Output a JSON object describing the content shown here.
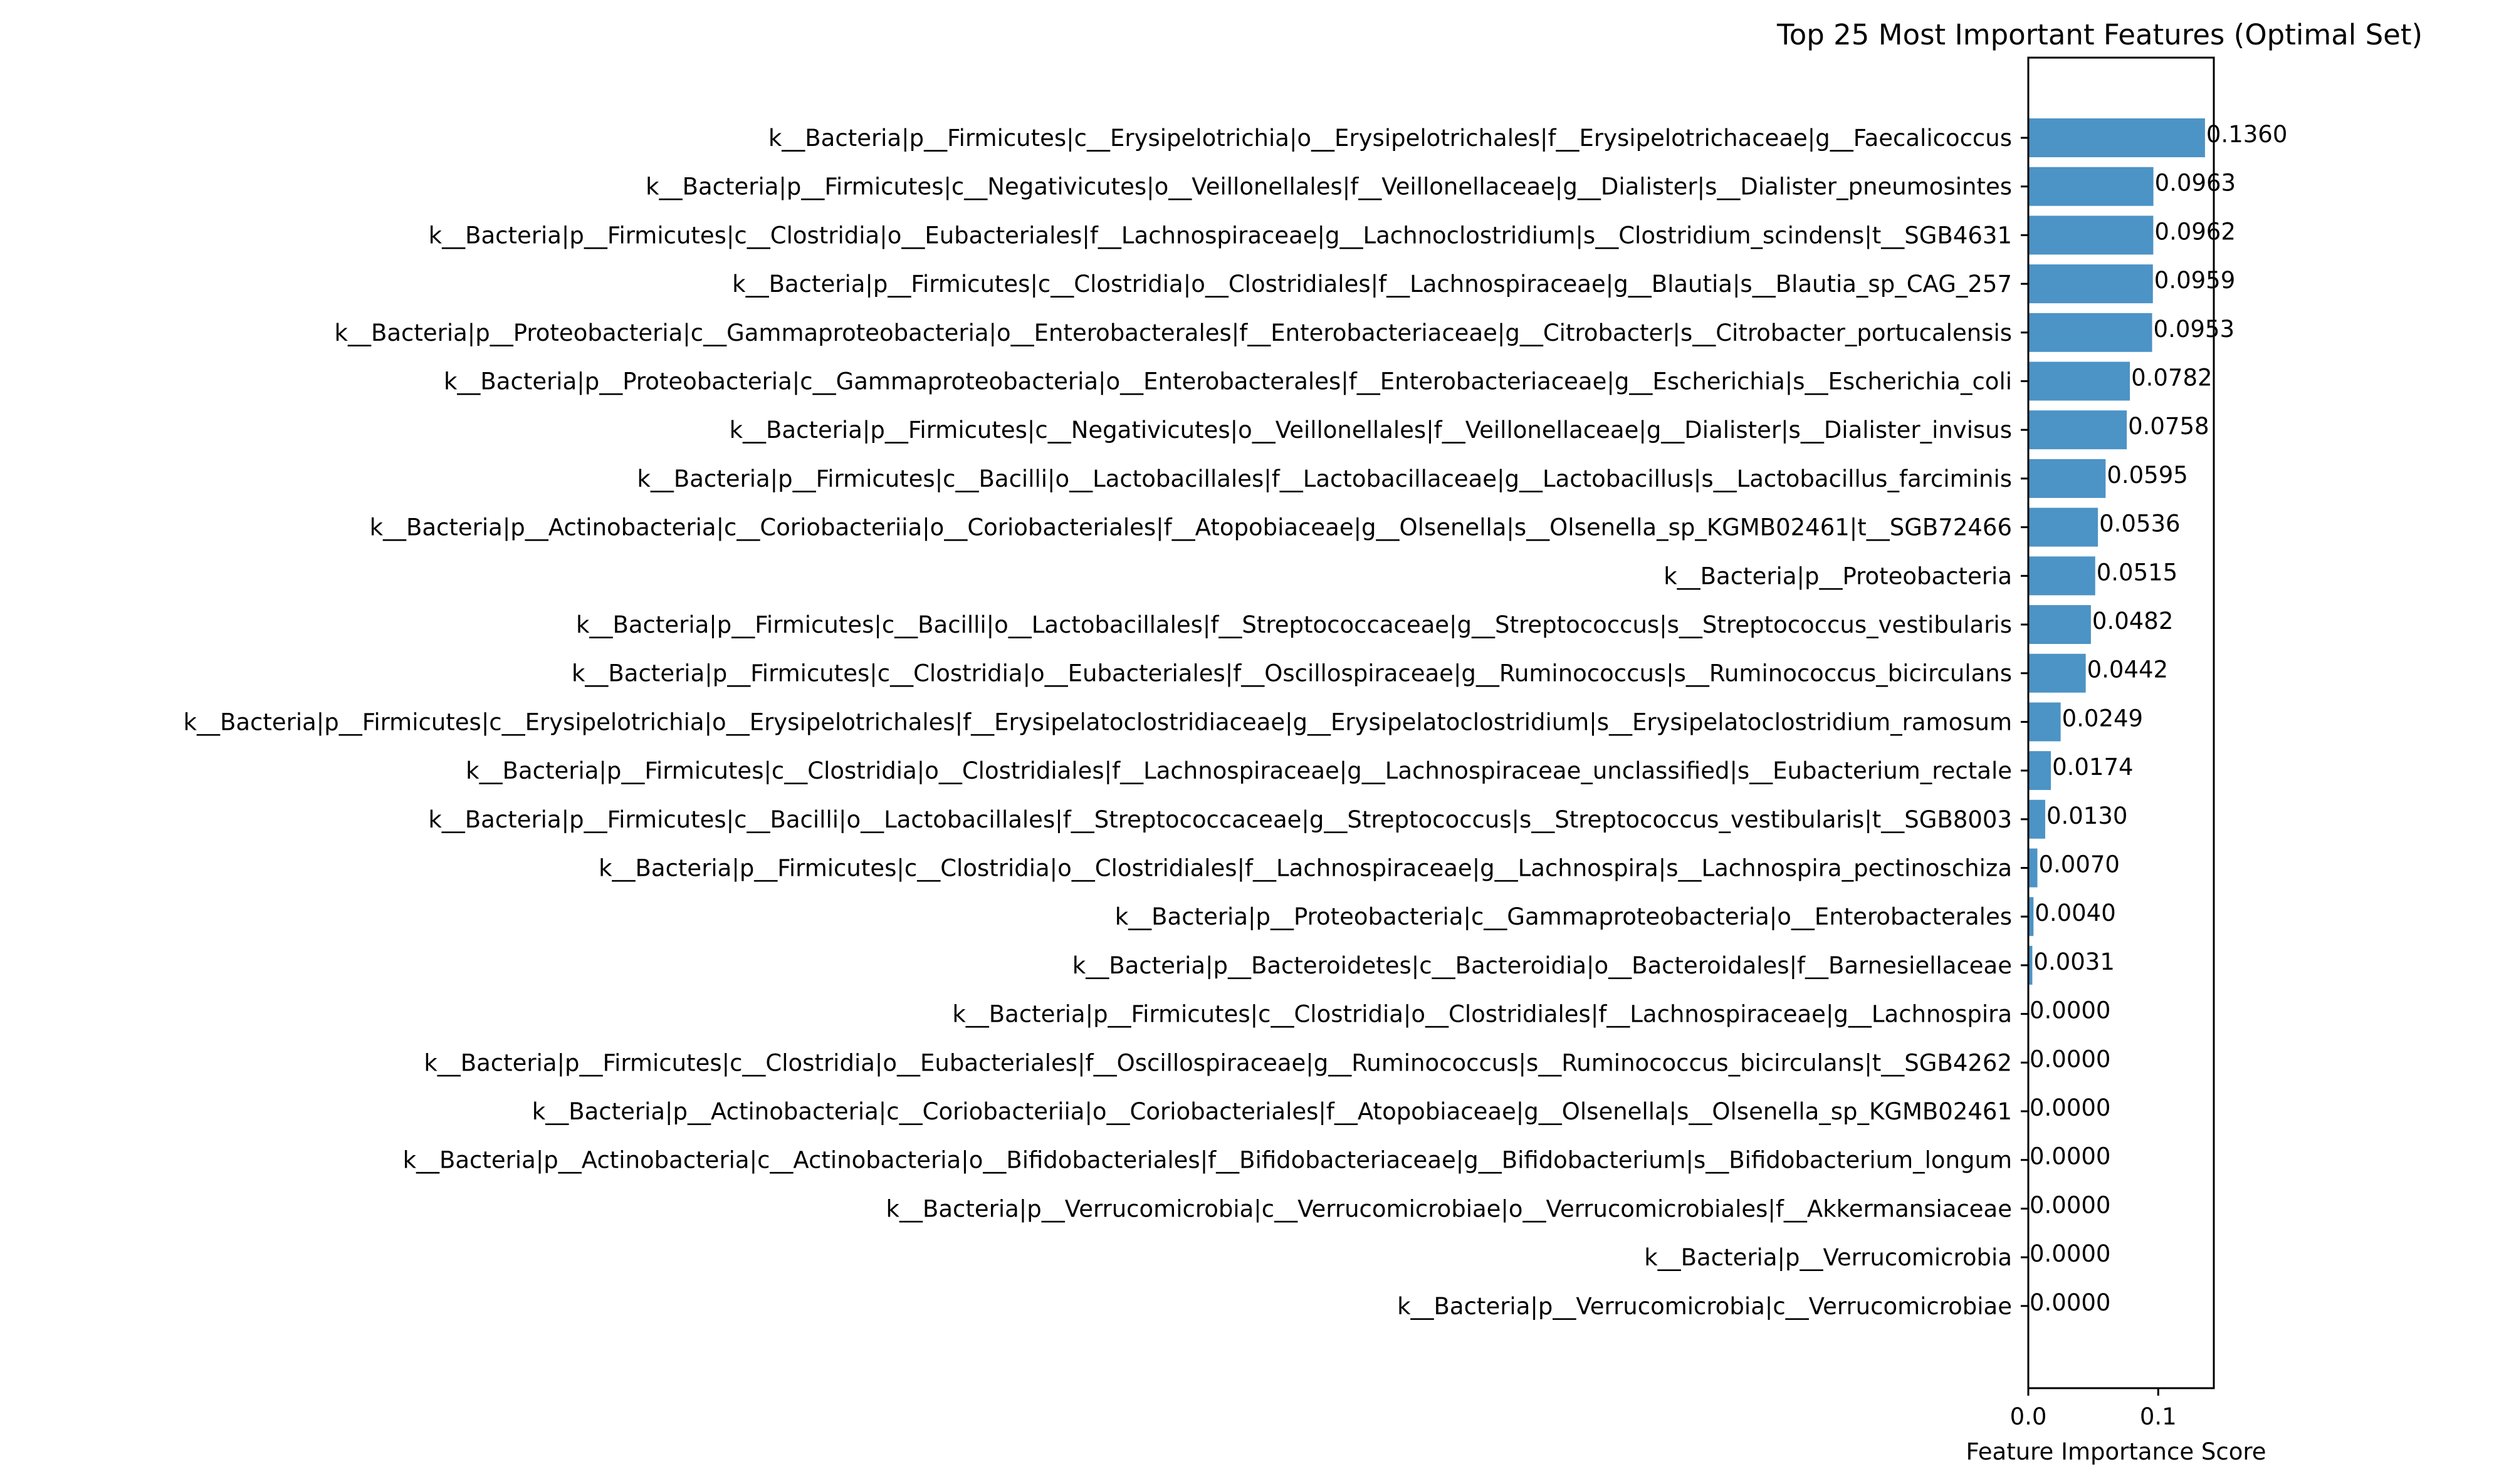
{
  "chart_data": {
    "type": "bar",
    "orientation": "horizontal",
    "title": "Top 25 Most Important Features (Optimal Set)",
    "xlabel": "Feature Importance Score",
    "ylabel": "",
    "xlim": [
      0,
      0.1428
    ],
    "xticks": [
      0.0,
      0.1
    ],
    "xtick_labels": [
      "0.0",
      "0.1"
    ],
    "grid": false,
    "bar_color": "#4c93c6",
    "value_label_format": "4 decimals",
    "categories": [
      "k__Bacteria|p__Firmicutes|c__Erysipelotrichia|o__Erysipelotrichales|f__Erysipelotrichaceae|g__Faecalicoccus",
      "k__Bacteria|p__Firmicutes|c__Negativicutes|o__Veillonellales|f__Veillonellaceae|g__Dialister|s__Dialister_pneumosintes",
      "k__Bacteria|p__Firmicutes|c__Clostridia|o__Eubacteriales|f__Lachnospiraceae|g__Lachnoclostridium|s__Clostridium_scindens|t__SGB4631",
      "k__Bacteria|p__Firmicutes|c__Clostridia|o__Clostridiales|f__Lachnospiraceae|g__Blautia|s__Blautia_sp_CAG_257",
      "k__Bacteria|p__Proteobacteria|c__Gammaproteobacteria|o__Enterobacterales|f__Enterobacteriaceae|g__Citrobacter|s__Citrobacter_portucalensis",
      "k__Bacteria|p__Proteobacteria|c__Gammaproteobacteria|o__Enterobacterales|f__Enterobacteriaceae|g__Escherichia|s__Escherichia_coli",
      "k__Bacteria|p__Firmicutes|c__Negativicutes|o__Veillonellales|f__Veillonellaceae|g__Dialister|s__Dialister_invisus",
      "k__Bacteria|p__Firmicutes|c__Bacilli|o__Lactobacillales|f__Lactobacillaceae|g__Lactobacillus|s__Lactobacillus_farciminis",
      "k__Bacteria|p__Actinobacteria|c__Coriobacteriia|o__Coriobacteriales|f__Atopobiaceae|g__Olsenella|s__Olsenella_sp_KGMB02461|t__SGB72466",
      "k__Bacteria|p__Proteobacteria",
      "k__Bacteria|p__Firmicutes|c__Bacilli|o__Lactobacillales|f__Streptococcaceae|g__Streptococcus|s__Streptococcus_vestibularis",
      "k__Bacteria|p__Firmicutes|c__Clostridia|o__Eubacteriales|f__Oscillospiraceae|g__Ruminococcus|s__Ruminococcus_bicirculans",
      "k__Bacteria|p__Firmicutes|c__Erysipelotrichia|o__Erysipelotrichales|f__Erysipelatoclostridiaceae|g__Erysipelatoclostridium|s__Erysipelatoclostridium_ramosum",
      "k__Bacteria|p__Firmicutes|c__Clostridia|o__Clostridiales|f__Lachnospiraceae|g__Lachnospiraceae_unclassified|s__Eubacterium_rectale",
      "k__Bacteria|p__Firmicutes|c__Bacilli|o__Lactobacillales|f__Streptococcaceae|g__Streptococcus|s__Streptococcus_vestibularis|t__SGB8003",
      "k__Bacteria|p__Firmicutes|c__Clostridia|o__Clostridiales|f__Lachnospiraceae|g__Lachnospira|s__Lachnospira_pectinoschiza",
      "k__Bacteria|p__Proteobacteria|c__Gammaproteobacteria|o__Enterobacterales",
      "k__Bacteria|p__Bacteroidetes|c__Bacteroidia|o__Bacteroidales|f__Barnesiellaceae",
      "k__Bacteria|p__Firmicutes|c__Clostridia|o__Clostridiales|f__Lachnospiraceae|g__Lachnospira",
      "k__Bacteria|p__Firmicutes|c__Clostridia|o__Eubacteriales|f__Oscillospiraceae|g__Ruminococcus|s__Ruminococcus_bicirculans|t__SGB4262",
      "k__Bacteria|p__Actinobacteria|c__Coriobacteriia|o__Coriobacteriales|f__Atopobiaceae|g__Olsenella|s__Olsenella_sp_KGMB02461",
      "k__Bacteria|p__Actinobacteria|c__Actinobacteria|o__Bifidobacteriales|f__Bifidobacteriaceae|g__Bifidobacterium|s__Bifidobacterium_longum",
      "k__Bacteria|p__Verrucomicrobia|c__Verrucomicrobiae|o__Verrucomicrobiales|f__Akkermansiaceae",
      "k__Bacteria|p__Verrucomicrobia",
      "k__Bacteria|p__Verrucomicrobia|c__Verrucomicrobiae"
    ],
    "values": [
      0.136,
      0.0963,
      0.0962,
      0.0959,
      0.0953,
      0.0782,
      0.0758,
      0.0595,
      0.0536,
      0.0515,
      0.0482,
      0.0442,
      0.0249,
      0.0174,
      0.013,
      0.007,
      0.004,
      0.0031,
      0.0,
      0.0,
      0.0,
      0.0,
      0.0,
      0.0,
      0.0
    ]
  }
}
